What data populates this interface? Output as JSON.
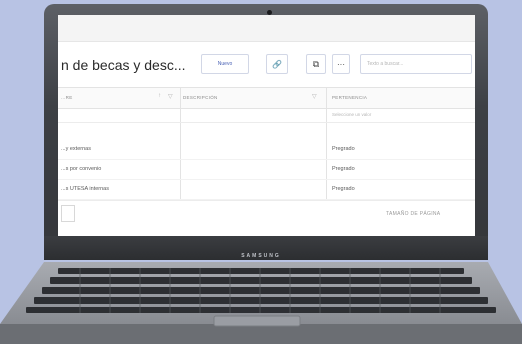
{
  "device": {
    "brand": "SAMSUNG"
  },
  "toolbar": {
    "title": "n de becas y desc...",
    "new_label": "Nuevo",
    "link_icon": "link-icon",
    "link_glyph": "🔗",
    "external_icon": "open-in-new-icon",
    "external_glyph": "⧉",
    "more_label": "···",
    "search_placeholder": "Texto a buscar..."
  },
  "table": {
    "columns": [
      {
        "label": "...RE"
      },
      {
        "label": "DESCRIPCIÓN"
      },
      {
        "label": "PERTENENCIA"
      }
    ],
    "filter_select_placeholder": "Seleccione un valor",
    "rows": [
      {
        "name": "...y externas",
        "description": "",
        "pertenencia": "Pregrado"
      },
      {
        "name": "...s por convenio",
        "description": "",
        "pertenencia": "Pregrado"
      },
      {
        "name": "...s UTESA internas",
        "description": "",
        "pertenencia": "Pregrado"
      }
    ]
  },
  "footer": {
    "page_size_label": "TAMAÑO DE PÁGINA"
  },
  "colors": {
    "accent": "#4a62b5",
    "background": "#b8c3e4"
  }
}
